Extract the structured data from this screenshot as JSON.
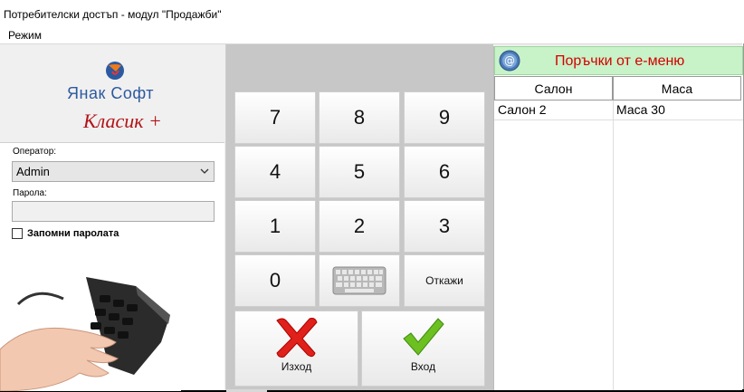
{
  "window": {
    "title": "Потребителски достъп - модул \"Продажби\""
  },
  "menu": {
    "items": [
      "Режим"
    ]
  },
  "logo": {
    "brand": "Янак Софт",
    "product": "Класик +"
  },
  "login": {
    "operator_label": "Оператор:",
    "operator_value": "Admin",
    "password_label": "Парола:",
    "password_value": "",
    "remember_label": "Запомни паролата",
    "remember_checked": false
  },
  "numpad": {
    "keys": [
      "7",
      "8",
      "9",
      "4",
      "5",
      "6",
      "1",
      "2",
      "3",
      "0"
    ],
    "cancel_label": "Откажи",
    "exit_label": "Изход",
    "enter_label": "Вход"
  },
  "orders": {
    "title": "Поръчки от е-меню",
    "columns": [
      "Салон",
      "Маса"
    ],
    "rows": [
      {
        "salon": "Салон 2",
        "table": "Маса 30"
      }
    ]
  },
  "colors": {
    "orders_header_bg": "#c8f2c8",
    "orders_title": "#d40000",
    "brand_blue": "#2a5aa0",
    "brand_red": "#b01418"
  }
}
